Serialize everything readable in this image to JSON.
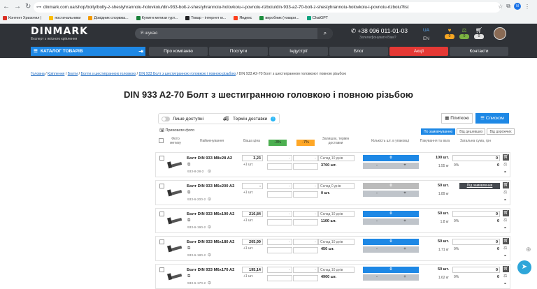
{
  "browser": {
    "url": "dinmark.com.ua/shop/bolty/bolty-z-shestyhrannoiu-holovkoiu/din-933-bolt-z-shestyhrannoiu-holovkoiu-i-povnoiu-rizboiu/din-933-a2-70-bolt-z-shestyhrannoiu-holovkoiu-i-povnoiu-rizboiu?list",
    "profile_initial": "N",
    "bookmarks": [
      "Контект Хризотил |",
      "постачальники",
      "Довідник спорвжа...",
      "Купити метизи гурт...",
      "Товар - інтернет м...",
      "Яндекс",
      "виробник (товари...",
      "ChatGPT"
    ]
  },
  "header": {
    "logo": "DINMARK",
    "logo_sub": "Експерт з якісного кріплення",
    "search_placeholder": "Я шукаю",
    "phone": "+38 096 011-01-03",
    "callback": "Зателефонувати Вам?",
    "lang_active": "UA",
    "lang_other": "EN",
    "icons": [
      {
        "name": "favorites",
        "count": "0"
      },
      {
        "name": "compare",
        "count": "0"
      },
      {
        "name": "cart",
        "count": "0"
      }
    ]
  },
  "menu": {
    "catalog": "КАТАЛОГ ТОВАРІВ",
    "items": [
      "Про компанію",
      "Послуги",
      "Індустрії",
      "Блог",
      "Акції",
      "Контакти"
    ]
  },
  "breadcrumbs": [
    "Головна",
    "Кріплення",
    "Болти",
    "Болти з шестигранною головкою",
    "DIN 933 Болт з шестигранною головкою і повною різьбою",
    "DIN 933 A2-70 Болт з шестигранною головкою і повною різьбою"
  ],
  "page_title": "DIN 933 A2-70 Болт з шестигранною головкою і повною різьбою",
  "filters": {
    "only_available": "Лише доступні",
    "delivery_term": "Термін доставки"
  },
  "view": {
    "tiles": "Плиткою",
    "list": "Списком"
  },
  "hide_photo": "Приховати фото",
  "sort": [
    "По замовчуванню",
    "Від дешевших",
    "Від дорожчих"
  ],
  "table_headers": {
    "photo": "Фото метизу",
    "name": "Найменування",
    "your_price": "Ваша ціна",
    "disc1": "-3%",
    "disc2": "-7%",
    "stock": "Залишок, термін доставки",
    "qty": "Кількість шт. в упаковці",
    "pack": "Пакування та вага",
    "total": "Загальна сума, грн"
  },
  "products": [
    {
      "name": "Болт DIN 933 M8x28 A2",
      "sku": "933-8-28-2",
      "price": "3,23",
      "per": "+1 шт.",
      "disc1": "-",
      "disc2": "-",
      "warehouse": "Склад 10 днів",
      "stock": "3700 шт.",
      "qty": "0",
      "pack": "100 шт.",
      "weight": "1.55 кг",
      "pct": "0%",
      "sum": "0",
      "sum2": "0",
      "available": true
    },
    {
      "name": "Болт DIN 933 M6x200 A2",
      "sku": "933-6-200-2",
      "price": "-",
      "per": "+1 шт.",
      "disc1": "-",
      "disc2": "-",
      "warehouse": "Склад 0 днів",
      "stock": "0 шт.",
      "qty": "0",
      "pack": "50 шт.",
      "weight": "1.89 кг",
      "preorder": "Під замовлення",
      "available": false
    },
    {
      "name": "Болт DIN 933 M6x190 A2",
      "sku": "933-6-190-2",
      "price": "216,84",
      "per": "+1 шт.",
      "disc1": "-",
      "disc2": "-",
      "warehouse": "Склад 10 днів",
      "stock": "1100 шт.",
      "qty": "0",
      "pack": "50 шт.",
      "weight": "1.8 кг",
      "pct": "0%",
      "sum": "0",
      "sum2": "0",
      "available": true
    },
    {
      "name": "Болт DIN 933 M6x180 A2",
      "sku": "933-6-180-2",
      "price": "205,99",
      "per": "+1 шт.",
      "disc1": "-",
      "disc2": "-",
      "warehouse": "Склад 10 днів",
      "stock": "450 шт.",
      "qty": "0",
      "pack": "50 шт.",
      "weight": "1.71 кг",
      "pct": "0%",
      "sum": "0",
      "sum2": "0",
      "available": true
    },
    {
      "name": "Болт DIN 933 M6x170 A2",
      "sku": "933-6-170-2",
      "price": "195,14",
      "per": "+1 шт.",
      "disc1": "-",
      "disc2": "-",
      "warehouse": "Склад 10 днів",
      "stock": "4900 шт.",
      "qty": "0",
      "pack": "50 шт.",
      "weight": "1.62 кг",
      "pct": "0%",
      "sum": "0",
      "sum2": "0",
      "available": true
    }
  ],
  "colors": {
    "accent": "#1e88e5",
    "header_bg": "#2f3237",
    "promo": "#e53935",
    "disc1": "#4caf50",
    "disc2": "#ffa726"
  }
}
